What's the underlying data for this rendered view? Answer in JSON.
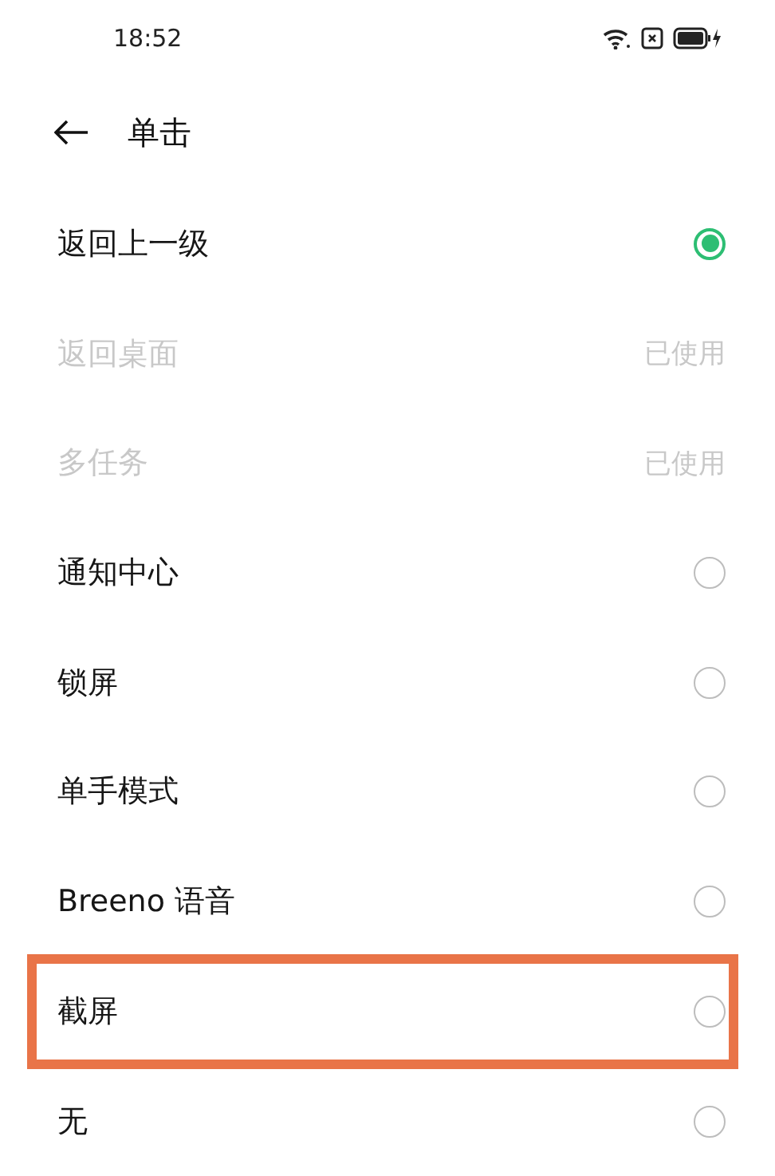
{
  "status_bar": {
    "time": "18:52"
  },
  "header": {
    "title": "单击"
  },
  "options": [
    {
      "label": "返回上一级",
      "kind": "radio",
      "selected": true,
      "disabled": false,
      "highlighted": false
    },
    {
      "label": "返回桌面",
      "kind": "used",
      "status": "已使用",
      "disabled": true,
      "highlighted": false
    },
    {
      "label": "多任务",
      "kind": "used",
      "status": "已使用",
      "disabled": true,
      "highlighted": false
    },
    {
      "label": "通知中心",
      "kind": "radio",
      "selected": false,
      "disabled": false,
      "highlighted": false
    },
    {
      "label": "锁屏",
      "kind": "radio",
      "selected": false,
      "disabled": false,
      "highlighted": false
    },
    {
      "label": "单手模式",
      "kind": "radio",
      "selected": false,
      "disabled": false,
      "highlighted": false
    },
    {
      "label": "Breeno 语音",
      "kind": "radio",
      "selected": false,
      "disabled": false,
      "highlighted": false
    },
    {
      "label": "截屏",
      "kind": "radio",
      "selected": false,
      "disabled": false,
      "highlighted": true
    },
    {
      "label": "无",
      "kind": "radio",
      "selected": false,
      "disabled": false,
      "highlighted": false
    }
  ]
}
